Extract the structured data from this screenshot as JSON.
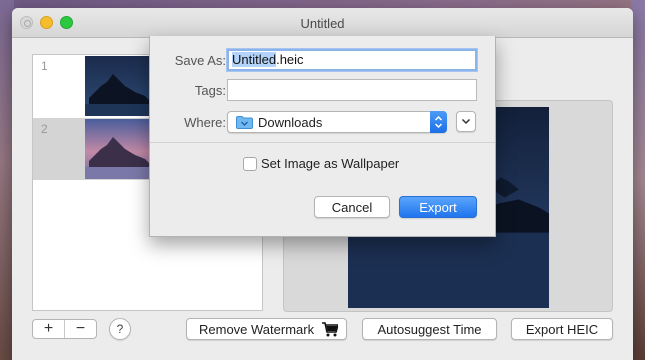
{
  "window": {
    "title": "Untitled"
  },
  "thumbnails": [
    {
      "number": "1"
    },
    {
      "number": "2"
    }
  ],
  "toolbar": {
    "add_label": "+",
    "remove_label": "−",
    "help_label": "?",
    "remove_watermark_label": "Remove Watermark",
    "autosuggest_label": "Autosuggest Time",
    "export_heic_label": "Export HEIC"
  },
  "dialog": {
    "save_as_label": "Save As:",
    "filename_selected": "Untitled",
    "filename_extension": ".heic",
    "tags_label": "Tags:",
    "tags_value": "",
    "where_label": "Where:",
    "where_value": "Downloads",
    "wallpaper_checkbox_label": "Set Image as Wallpaper",
    "wallpaper_checked": false,
    "cancel_label": "Cancel",
    "export_label": "Export"
  },
  "icons": [
    "close-icon",
    "minimize-icon",
    "zoom-icon",
    "cart-icon",
    "folder-icon",
    "up-down-arrows-icon",
    "chevron-down-icon"
  ],
  "colors": {
    "accent": "#2074ee",
    "selection": "#b3d3fb",
    "traffic_min": "#f5bd2b",
    "traffic_max": "#2ac940"
  }
}
